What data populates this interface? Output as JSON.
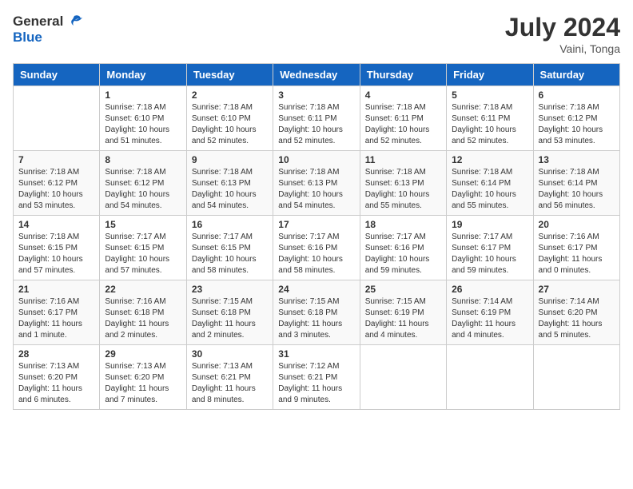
{
  "header": {
    "logo_general": "General",
    "logo_blue": "Blue",
    "month_year": "July 2024",
    "location": "Vaini, Tonga"
  },
  "weekdays": [
    "Sunday",
    "Monday",
    "Tuesday",
    "Wednesday",
    "Thursday",
    "Friday",
    "Saturday"
  ],
  "weeks": [
    [
      {
        "day": "",
        "sunrise": "",
        "sunset": "",
        "daylight": ""
      },
      {
        "day": "1",
        "sunrise": "Sunrise: 7:18 AM",
        "sunset": "Sunset: 6:10 PM",
        "daylight": "Daylight: 10 hours and 51 minutes."
      },
      {
        "day": "2",
        "sunrise": "Sunrise: 7:18 AM",
        "sunset": "Sunset: 6:10 PM",
        "daylight": "Daylight: 10 hours and 52 minutes."
      },
      {
        "day": "3",
        "sunrise": "Sunrise: 7:18 AM",
        "sunset": "Sunset: 6:11 PM",
        "daylight": "Daylight: 10 hours and 52 minutes."
      },
      {
        "day": "4",
        "sunrise": "Sunrise: 7:18 AM",
        "sunset": "Sunset: 6:11 PM",
        "daylight": "Daylight: 10 hours and 52 minutes."
      },
      {
        "day": "5",
        "sunrise": "Sunrise: 7:18 AM",
        "sunset": "Sunset: 6:11 PM",
        "daylight": "Daylight: 10 hours and 52 minutes."
      },
      {
        "day": "6",
        "sunrise": "Sunrise: 7:18 AM",
        "sunset": "Sunset: 6:12 PM",
        "daylight": "Daylight: 10 hours and 53 minutes."
      }
    ],
    [
      {
        "day": "7",
        "sunrise": "Sunrise: 7:18 AM",
        "sunset": "Sunset: 6:12 PM",
        "daylight": "Daylight: 10 hours and 53 minutes."
      },
      {
        "day": "8",
        "sunrise": "Sunrise: 7:18 AM",
        "sunset": "Sunset: 6:12 PM",
        "daylight": "Daylight: 10 hours and 54 minutes."
      },
      {
        "day": "9",
        "sunrise": "Sunrise: 7:18 AM",
        "sunset": "Sunset: 6:13 PM",
        "daylight": "Daylight: 10 hours and 54 minutes."
      },
      {
        "day": "10",
        "sunrise": "Sunrise: 7:18 AM",
        "sunset": "Sunset: 6:13 PM",
        "daylight": "Daylight: 10 hours and 54 minutes."
      },
      {
        "day": "11",
        "sunrise": "Sunrise: 7:18 AM",
        "sunset": "Sunset: 6:13 PM",
        "daylight": "Daylight: 10 hours and 55 minutes."
      },
      {
        "day": "12",
        "sunrise": "Sunrise: 7:18 AM",
        "sunset": "Sunset: 6:14 PM",
        "daylight": "Daylight: 10 hours and 55 minutes."
      },
      {
        "day": "13",
        "sunrise": "Sunrise: 7:18 AM",
        "sunset": "Sunset: 6:14 PM",
        "daylight": "Daylight: 10 hours and 56 minutes."
      }
    ],
    [
      {
        "day": "14",
        "sunrise": "Sunrise: 7:18 AM",
        "sunset": "Sunset: 6:15 PM",
        "daylight": "Daylight: 10 hours and 57 minutes."
      },
      {
        "day": "15",
        "sunrise": "Sunrise: 7:17 AM",
        "sunset": "Sunset: 6:15 PM",
        "daylight": "Daylight: 10 hours and 57 minutes."
      },
      {
        "day": "16",
        "sunrise": "Sunrise: 7:17 AM",
        "sunset": "Sunset: 6:15 PM",
        "daylight": "Daylight: 10 hours and 58 minutes."
      },
      {
        "day": "17",
        "sunrise": "Sunrise: 7:17 AM",
        "sunset": "Sunset: 6:16 PM",
        "daylight": "Daylight: 10 hours and 58 minutes."
      },
      {
        "day": "18",
        "sunrise": "Sunrise: 7:17 AM",
        "sunset": "Sunset: 6:16 PM",
        "daylight": "Daylight: 10 hours and 59 minutes."
      },
      {
        "day": "19",
        "sunrise": "Sunrise: 7:17 AM",
        "sunset": "Sunset: 6:17 PM",
        "daylight": "Daylight: 10 hours and 59 minutes."
      },
      {
        "day": "20",
        "sunrise": "Sunrise: 7:16 AM",
        "sunset": "Sunset: 6:17 PM",
        "daylight": "Daylight: 11 hours and 0 minutes."
      }
    ],
    [
      {
        "day": "21",
        "sunrise": "Sunrise: 7:16 AM",
        "sunset": "Sunset: 6:17 PM",
        "daylight": "Daylight: 11 hours and 1 minute."
      },
      {
        "day": "22",
        "sunrise": "Sunrise: 7:16 AM",
        "sunset": "Sunset: 6:18 PM",
        "daylight": "Daylight: 11 hours and 2 minutes."
      },
      {
        "day": "23",
        "sunrise": "Sunrise: 7:15 AM",
        "sunset": "Sunset: 6:18 PM",
        "daylight": "Daylight: 11 hours and 2 minutes."
      },
      {
        "day": "24",
        "sunrise": "Sunrise: 7:15 AM",
        "sunset": "Sunset: 6:18 PM",
        "daylight": "Daylight: 11 hours and 3 minutes."
      },
      {
        "day": "25",
        "sunrise": "Sunrise: 7:15 AM",
        "sunset": "Sunset: 6:19 PM",
        "daylight": "Daylight: 11 hours and 4 minutes."
      },
      {
        "day": "26",
        "sunrise": "Sunrise: 7:14 AM",
        "sunset": "Sunset: 6:19 PM",
        "daylight": "Daylight: 11 hours and 4 minutes."
      },
      {
        "day": "27",
        "sunrise": "Sunrise: 7:14 AM",
        "sunset": "Sunset: 6:20 PM",
        "daylight": "Daylight: 11 hours and 5 minutes."
      }
    ],
    [
      {
        "day": "28",
        "sunrise": "Sunrise: 7:13 AM",
        "sunset": "Sunset: 6:20 PM",
        "daylight": "Daylight: 11 hours and 6 minutes."
      },
      {
        "day": "29",
        "sunrise": "Sunrise: 7:13 AM",
        "sunset": "Sunset: 6:20 PM",
        "daylight": "Daylight: 11 hours and 7 minutes."
      },
      {
        "day": "30",
        "sunrise": "Sunrise: 7:13 AM",
        "sunset": "Sunset: 6:21 PM",
        "daylight": "Daylight: 11 hours and 8 minutes."
      },
      {
        "day": "31",
        "sunrise": "Sunrise: 7:12 AM",
        "sunset": "Sunset: 6:21 PM",
        "daylight": "Daylight: 11 hours and 9 minutes."
      },
      {
        "day": "",
        "sunrise": "",
        "sunset": "",
        "daylight": ""
      },
      {
        "day": "",
        "sunrise": "",
        "sunset": "",
        "daylight": ""
      },
      {
        "day": "",
        "sunrise": "",
        "sunset": "",
        "daylight": ""
      }
    ]
  ]
}
